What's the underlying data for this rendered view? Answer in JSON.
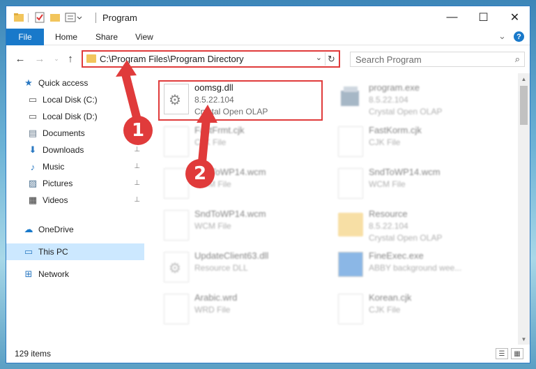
{
  "window": {
    "title": "Program",
    "controls": {
      "minimize": "—",
      "maximize": "☐",
      "close": "✕"
    }
  },
  "ribbon": {
    "tabs": [
      "File",
      "Home",
      "Share",
      "View"
    ],
    "help": "?",
    "expand": "⌄"
  },
  "nav": {
    "back": "←",
    "forward": "→",
    "up": "↑",
    "address": "C:\\Program Files\\Program Directory",
    "dropdown": "⌄",
    "refresh": "↻",
    "search_placeholder": "Search Program",
    "search_icon": "⌕"
  },
  "navpane": {
    "items": [
      {
        "label": "Quick access",
        "icon": "star-icon",
        "glyph": "★",
        "pinned": false
      },
      {
        "label": "Local Disk (C:)",
        "icon": "drive-icon",
        "glyph": "▭",
        "pinned": false
      },
      {
        "label": "Local Disk (D:)",
        "icon": "drive-icon",
        "glyph": "▭",
        "pinned": false
      },
      {
        "label": "Documents",
        "icon": "documents-icon",
        "glyph": "▤",
        "pinned": false
      },
      {
        "label": "Downloads",
        "icon": "downloads-icon",
        "glyph": "⬇",
        "pinned": true
      },
      {
        "label": "Music",
        "icon": "music-icon",
        "glyph": "♪",
        "pinned": true
      },
      {
        "label": "Pictures",
        "icon": "pictures-icon",
        "glyph": "▨",
        "pinned": true
      },
      {
        "label": "Videos",
        "icon": "videos-icon",
        "glyph": "▦",
        "pinned": true
      },
      {
        "label": "OneDrive",
        "icon": "onedrive-icon",
        "glyph": "☁",
        "pinned": false
      },
      {
        "label": "This PC",
        "icon": "computer-icon",
        "glyph": "▭",
        "pinned": false
      },
      {
        "label": "Network",
        "icon": "network-icon",
        "glyph": "⊞",
        "pinned": false
      }
    ],
    "pin_glyph": "📌"
  },
  "files": {
    "highlighted": {
      "name": "oomsg.dll",
      "version": "8.5.22.104",
      "company": "Crystal Open OLAP"
    },
    "others": [
      {
        "name": "program.exe",
        "line2": "8.5.22.104",
        "line3": "Crystal Open OLAP",
        "kind": "exe"
      },
      {
        "name": "FastFrmt.cjk",
        "line2": "CJK File",
        "line3": "",
        "kind": "doc"
      },
      {
        "name": "FastKorm.cjk",
        "line2": "CJK File",
        "line3": "",
        "kind": "doc"
      },
      {
        "name": "SndToWP14.wcm",
        "line2": "WCM File",
        "line3": "",
        "kind": "doc"
      },
      {
        "name": "SndToWP14.wcm",
        "line2": "WCM File",
        "line3": "",
        "kind": "doc"
      },
      {
        "name": "SndToWP14.wcm",
        "line2": "WCM File",
        "line3": "",
        "kind": "doc"
      },
      {
        "name": "Resource",
        "line2": "8.5.22.104",
        "line3": "Crystal Open OLAP",
        "kind": "folder"
      },
      {
        "name": "UpdateClient63.dll",
        "line2": "Resource DLL",
        "line3": "",
        "kind": "gear"
      },
      {
        "name": "FineExec.exe",
        "line2": "ABBY background wee...",
        "line3": "",
        "kind": "exe2"
      },
      {
        "name": "Arabic.wrd",
        "line2": "WRD File",
        "line3": "",
        "kind": "doc"
      },
      {
        "name": "Korean.cjk",
        "line2": "CJK File",
        "line3": "",
        "kind": "doc"
      }
    ]
  },
  "status": {
    "count": "129 items",
    "view_details": "☰",
    "view_tiles": "▦"
  },
  "annotations": {
    "step1": "1",
    "step2": "2",
    "color": "#e03b3b"
  }
}
